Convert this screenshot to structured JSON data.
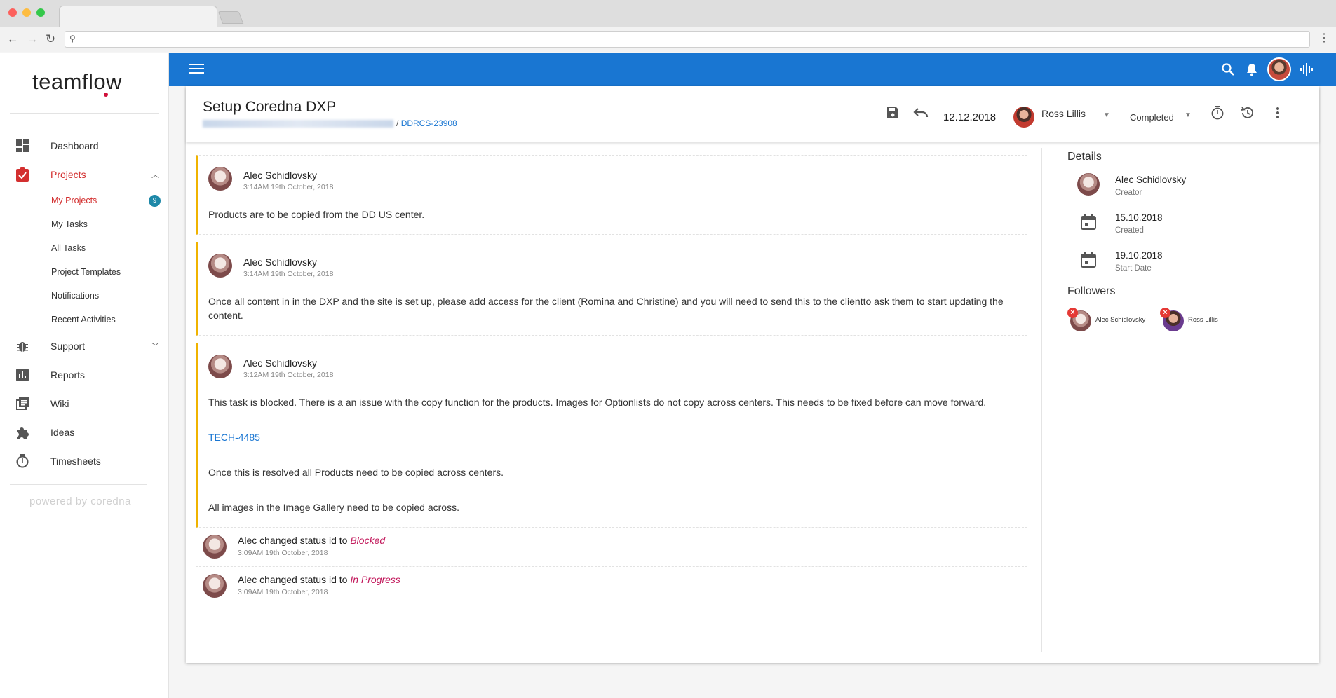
{
  "app": {
    "logo": "teamflow",
    "powered_by": "powered by coredna"
  },
  "sidebar": {
    "items": [
      {
        "label": "Dashboard",
        "icon": "dashboard-icon"
      },
      {
        "label": "Projects",
        "icon": "clipboard-check-icon",
        "active": true
      },
      {
        "label": "Support",
        "icon": "bug-icon"
      },
      {
        "label": "Reports",
        "icon": "bar-chart-icon"
      },
      {
        "label": "Wiki",
        "icon": "library-icon"
      },
      {
        "label": "Ideas",
        "icon": "puzzle-icon"
      },
      {
        "label": "Timesheets",
        "icon": "stopwatch-icon"
      }
    ],
    "project_sub": [
      {
        "label": "My Projects",
        "badge": "9"
      },
      {
        "label": "My Tasks"
      },
      {
        "label": "All Tasks"
      },
      {
        "label": "Project Templates"
      },
      {
        "label": "Notifications"
      },
      {
        "label": "Recent Activities"
      }
    ]
  },
  "task": {
    "title": "Setup Coredna DXP",
    "code": "DDRCS-23908",
    "crumb_sep": "/",
    "date": "12.12.2018",
    "assignee": "Ross Lillis",
    "status": "Completed"
  },
  "comments": [
    {
      "author": "Alec Schidlovsky",
      "time": "3:14AM 19th October, 2018",
      "paragraphs": [
        "Products are to be copied from the DD US center."
      ]
    },
    {
      "author": "Alec Schidlovsky",
      "time": "3:14AM 19th October, 2018",
      "paragraphs": [
        "Once all content in in the DXP and the site is set up, please add access for the client (Romina and Christine) and you will need to send this to the clientto ask them to start updating the content."
      ]
    },
    {
      "author": "Alec Schidlovsky",
      "time": "3:12AM 19th October, 2018",
      "paragraphs": [
        "This task is blocked. There is a an issue with the copy function for the products. Images for Optionlists do not copy across centers. This needs to be fixed before can move forward.",
        "TECH-4485",
        "Once this is resolved all Products need to be copied across centers.",
        "All images in the Image Gallery need to be copied across."
      ]
    }
  ],
  "logs": [
    {
      "prefix": "Alec changed status id to ",
      "status": "Blocked",
      "time": "3:09AM 19th October, 2018"
    },
    {
      "prefix": "Alec changed status id to ",
      "status": "In Progress",
      "time": "3:09AM 19th October, 2018"
    }
  ],
  "details": {
    "heading": "Details",
    "creator": {
      "value": "Alec Schidlovsky",
      "label": "Creator"
    },
    "created": {
      "value": "15.10.2018",
      "label": "Created"
    },
    "start": {
      "value": "19.10.2018",
      "label": "Start Date"
    },
    "followers_heading": "Followers",
    "followers": [
      "Alec Schidlovsky",
      "Ross Lillis"
    ]
  },
  "colors": {
    "primary": "#1976d2",
    "accent": "#d32f2f",
    "comment_bar": "#f0b300",
    "status": "#c2185b",
    "badge": "#1e88a8"
  }
}
